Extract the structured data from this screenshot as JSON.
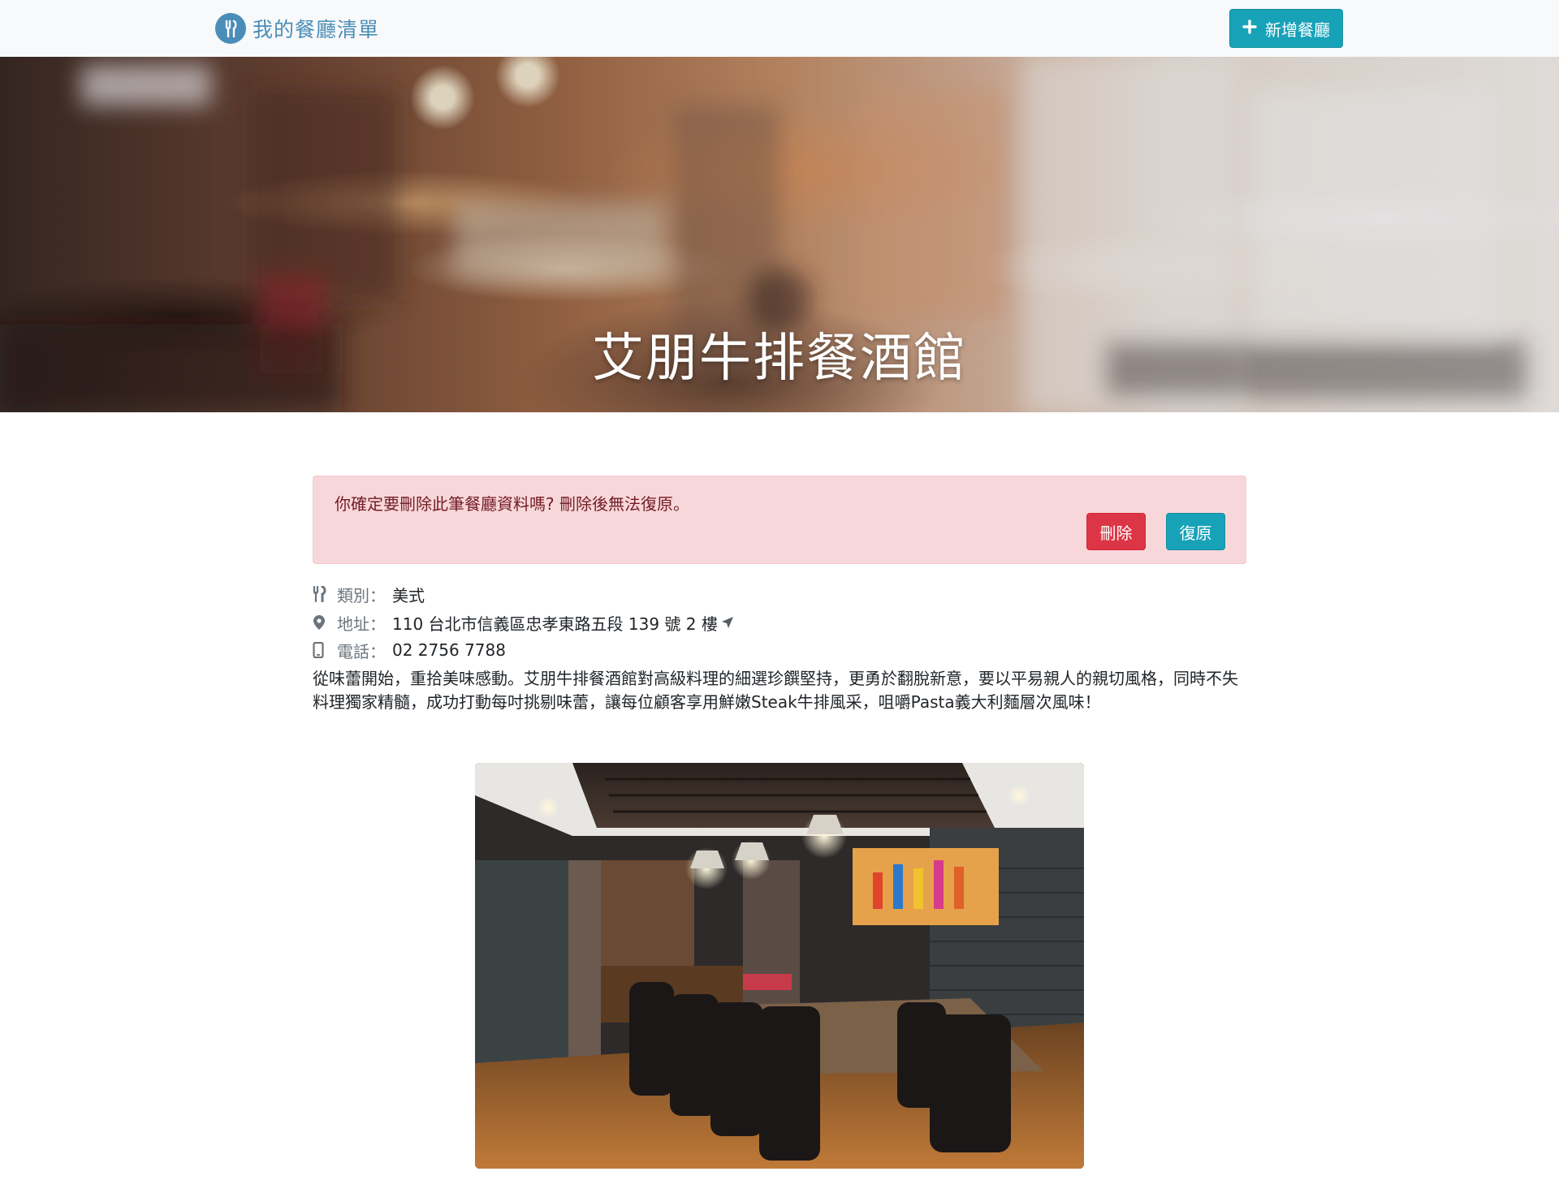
{
  "navbar": {
    "brand_text": "我的餐廳清單",
    "brand_icon": "utensils-icon",
    "add_button_label": "新增餐廳",
    "add_button_icon": "plus-icon",
    "accent_color": "#17a2b8",
    "brand_color": "#4a8db8"
  },
  "hero": {
    "title": "艾朋牛排餐酒館"
  },
  "alert": {
    "message": "你確定要刪除此筆餐廳資料嗎? 刪除後無法復原。",
    "delete_label": "刪除",
    "restore_label": "復原",
    "delete_color": "#dc3545",
    "restore_color": "#17a2b8"
  },
  "restaurant": {
    "category_label": "類別：",
    "category_value": "美式",
    "address_label": "地址：",
    "address_value": "110 台北市信義區忠孝東路五段 139 號 2 樓",
    "phone_label": "電話：",
    "phone_value": "02 2756 7788",
    "description": "從味蕾開始，重拾美味感動。艾朋牛排餐酒館對高級料理的細選珍饌堅持，更勇於翻脫新意，要以平易親人的親切風格，同時不失料理獨家精髓，成功打動每吋挑剔味蕾，讓每位顧客享用鮮嫩Steak牛排風采，咀嚼Pasta義大利麵層次風味！"
  },
  "icons": {
    "category": "utensils-icon",
    "address": "map-marker-icon",
    "address_action": "location-arrow-icon",
    "phone": "mobile-phone-icon"
  }
}
